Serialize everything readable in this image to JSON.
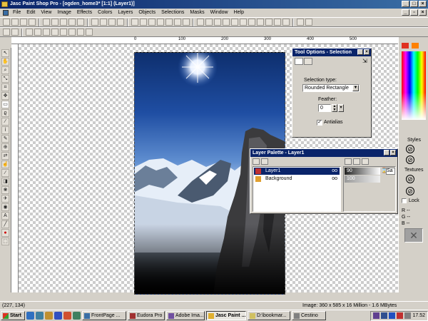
{
  "window": {
    "title": "Jasc Paint Shop Pro - [ogden_home3* [1:1] (Layer1)]"
  },
  "menu": [
    "File",
    "Edit",
    "View",
    "Image",
    "Effects",
    "Colors",
    "Layers",
    "Objects",
    "Selections",
    "Masks",
    "Window",
    "Help"
  ],
  "ruler": {
    "ticks": [
      "0",
      "100",
      "200",
      "300",
      "400",
      "500"
    ]
  },
  "tool_options": {
    "title": "Tool Options - Selection",
    "selection_type_label": "Selection type:",
    "selection_type_value": "Rounded Rectangle",
    "feather_label": "Feather:",
    "feather_value": "0",
    "antialias_label": "Antialias",
    "antialias_checked": true
  },
  "layer_palette": {
    "title": "Layer Palette - Layer1",
    "layers": [
      {
        "name": "Layer1",
        "opacity": "90",
        "selected": true
      },
      {
        "name": "Background",
        "opacity": "100",
        "selected": false
      }
    ],
    "blend_mode": "Sa"
  },
  "right_panel": {
    "styles_label": "Styles",
    "textures_label": "Textures",
    "lock_label": "Lock",
    "rgb": [
      "R --",
      "G --",
      "B --"
    ],
    "fg_color": "#e03020",
    "bg_color": "#ff8000"
  },
  "status": {
    "coords": "(227, 134)",
    "image_info": "Image: 360 x 585 x 16 Million - 1.6 MBytes"
  },
  "taskbar": {
    "start_label": "Start",
    "buttons": [
      {
        "label": "FrontPage ...",
        "active": false
      },
      {
        "label": "Eudora Pro",
        "active": false
      },
      {
        "label": "Adobe Ima...",
        "active": false
      },
      {
        "label": "Jasc Paint ...",
        "active": true
      },
      {
        "label": "D:\\bookmar...",
        "active": false
      },
      {
        "label": "Cestino",
        "active": false
      }
    ],
    "clock": "17.52"
  }
}
